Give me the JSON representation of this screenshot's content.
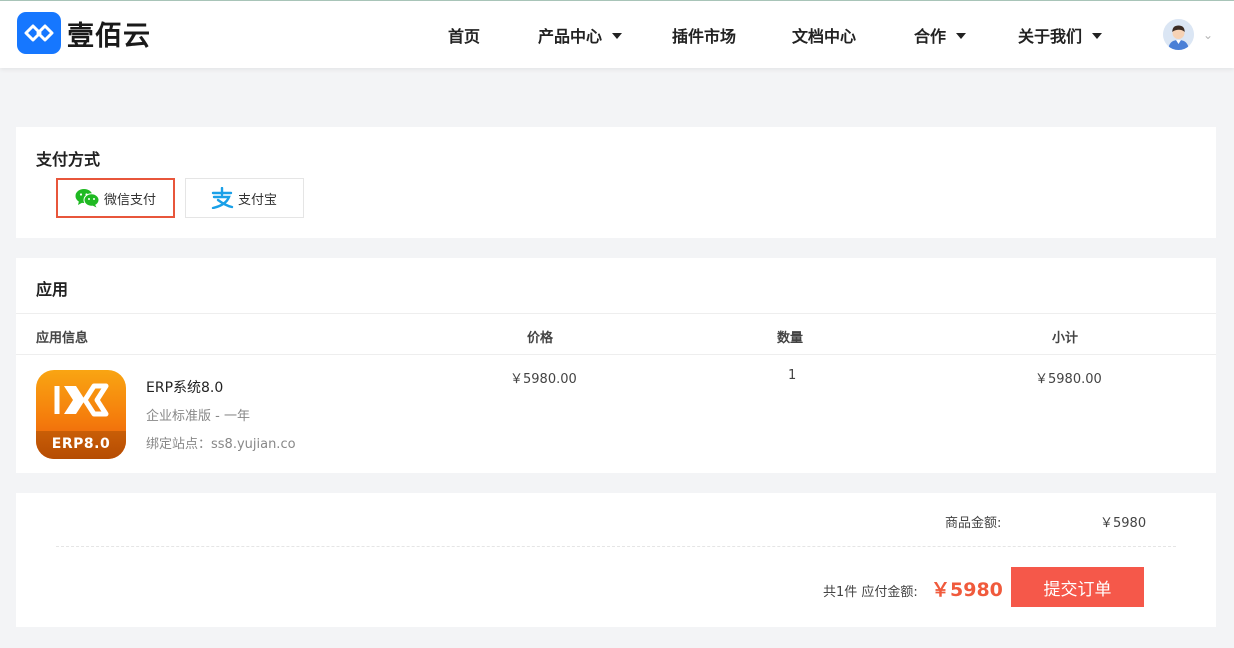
{
  "header": {
    "brand": "壹佰云",
    "nav": [
      {
        "label": "首页",
        "has_dropdown": false
      },
      {
        "label": "产品中心",
        "has_dropdown": true
      },
      {
        "label": "插件市场",
        "has_dropdown": false
      },
      {
        "label": "文档中心",
        "has_dropdown": false
      },
      {
        "label": "合作",
        "has_dropdown": true
      },
      {
        "label": "关于我们",
        "has_dropdown": true
      }
    ],
    "user_chevron": "⌄"
  },
  "payment": {
    "title": "支付方式",
    "options": [
      {
        "label": "微信支付",
        "icon": "wechat-icon",
        "selected": true
      },
      {
        "label": "支付宝",
        "icon": "alipay-icon",
        "selected": false
      }
    ]
  },
  "app_section": {
    "title": "应用",
    "columns": [
      "应用信息",
      "价格",
      "数量",
      "小计"
    ],
    "item": {
      "icon_tag": "ERP8.0",
      "name": "ERP系统8.0",
      "edition": "企业标准版 - 一年",
      "site": "绑定站点：ss8.yujian.co",
      "price": "￥5980.00",
      "quantity": "1",
      "subtotal": "￥5980.00"
    }
  },
  "summary": {
    "goods_label": "商品金额:",
    "goods_value": "￥5980",
    "total_label": "共1件 应付金额:",
    "total_value": "￥5980",
    "submit_label": "提交订单"
  },
  "colors": {
    "brand": "#1677ff",
    "accent": "#f5584a",
    "selected_border": "#e8563b"
  }
}
